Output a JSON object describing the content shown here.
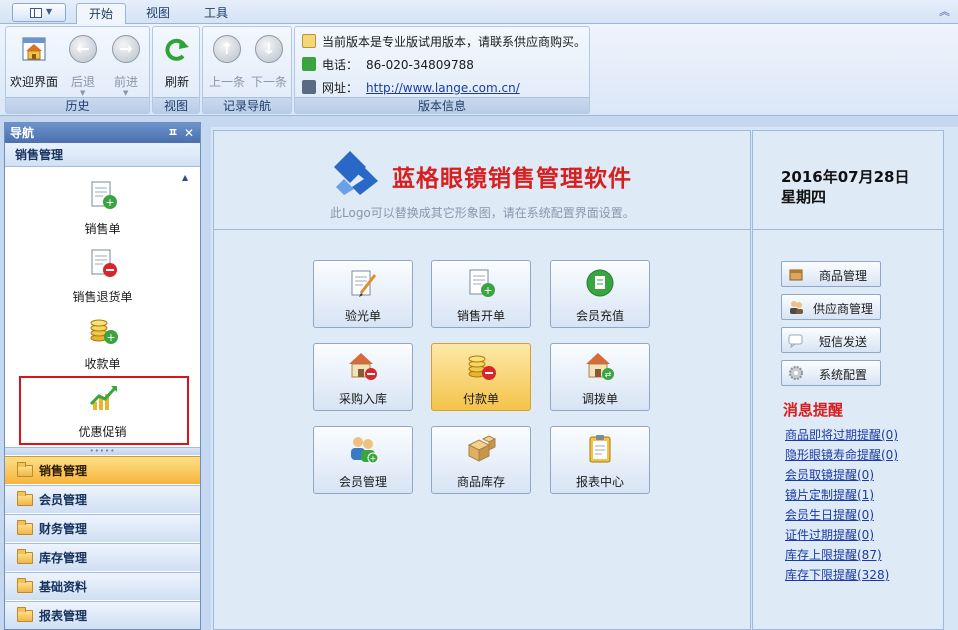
{
  "ribbon": {
    "tabs": [
      {
        "label": "开始",
        "active": true
      },
      {
        "label": "视图",
        "active": false
      },
      {
        "label": "工具",
        "active": false
      }
    ],
    "groups": {
      "history": {
        "label": "历史",
        "buttons": [
          {
            "label": "欢迎界面",
            "icon": "home-icon",
            "enabled": true
          },
          {
            "label": "后退",
            "icon": "back-arrow-icon",
            "enabled": false
          },
          {
            "label": "前进",
            "icon": "forward-arrow-icon",
            "enabled": false
          }
        ]
      },
      "view": {
        "label": "视图",
        "buttons": [
          {
            "label": "刷新",
            "icon": "refresh-icon",
            "enabled": true
          }
        ]
      },
      "record_nav": {
        "label": "记录导航",
        "buttons": [
          {
            "label": "上一条",
            "icon": "up-arrow-icon",
            "enabled": false
          },
          {
            "label": "下一条",
            "icon": "down-arrow-icon",
            "enabled": false
          }
        ]
      },
      "version": {
        "label": "版本信息",
        "notice": "当前版本是专业版试用版本，请联系供应商购买。",
        "phone_label": "电话：",
        "phone": "86-020-34809788",
        "site_label": "网址：",
        "site": "http://www.lange.com.cn/"
      }
    }
  },
  "nav": {
    "header": "导航",
    "section_title": "销售管理",
    "items": [
      {
        "label": "销售单",
        "icon": "sales-order-icon"
      },
      {
        "label": "销售退货单",
        "icon": "sales-return-icon"
      },
      {
        "label": "收款单",
        "icon": "receipt-coins-icon"
      },
      {
        "label": "优惠促销",
        "icon": "promotion-chart-icon",
        "selected": true
      }
    ],
    "categories": [
      {
        "label": "销售管理",
        "active": true
      },
      {
        "label": "会员管理",
        "active": false
      },
      {
        "label": "财务管理",
        "active": false
      },
      {
        "label": "库存管理",
        "active": false
      },
      {
        "label": "基础资料",
        "active": false
      },
      {
        "label": "报表管理",
        "active": false
      }
    ]
  },
  "main": {
    "logo_title": "蓝格眼镜销售管理软件",
    "logo_hint": "此Logo可以替换成其它形象图，请在系统配置界面设置。",
    "date": "2016年07月28日",
    "weekday": "星期四",
    "functions": [
      {
        "label": "验光单",
        "icon": "prescription-icon",
        "active": false
      },
      {
        "label": "销售开单",
        "icon": "sales-order-icon",
        "active": false
      },
      {
        "label": "会员充值",
        "icon": "member-recharge-icon",
        "active": false
      },
      {
        "label": "采购入库",
        "icon": "purchase-house-icon",
        "active": false
      },
      {
        "label": "付款单",
        "icon": "payment-coins-icon",
        "active": true
      },
      {
        "label": "调拨单",
        "icon": "transfer-house-icon",
        "active": false
      },
      {
        "label": "会员管理",
        "icon": "members-icon",
        "active": false
      },
      {
        "label": "商品库存",
        "icon": "boxes-icon",
        "active": false
      },
      {
        "label": "报表中心",
        "icon": "clipboard-icon",
        "active": false
      }
    ],
    "side_buttons": [
      {
        "label": "商品管理",
        "icon": "product-box-icon"
      },
      {
        "label": "供应商管理",
        "icon": "supplier-people-icon"
      },
      {
        "label": "短信发送",
        "icon": "sms-bubble-icon"
      },
      {
        "label": "系统配置",
        "icon": "gear-icon"
      }
    ],
    "messages_title": "消息提醒",
    "messages": [
      "商品即将过期提醒(0)",
      "隐形眼镜寿命提醒(0)",
      "会员取镜提醒(0)",
      "镜片定制提醒(1)",
      "会员生日提醒(0)",
      "证件过期提醒(0)",
      "库存上限提醒(87)",
      "库存下限提醒(328)"
    ]
  },
  "colors": {
    "accent_red": "#d81e1e",
    "nav_header_blue": "#4a70ad",
    "active_orange": "#f6b43b",
    "link_blue": "#1a3aa8"
  }
}
